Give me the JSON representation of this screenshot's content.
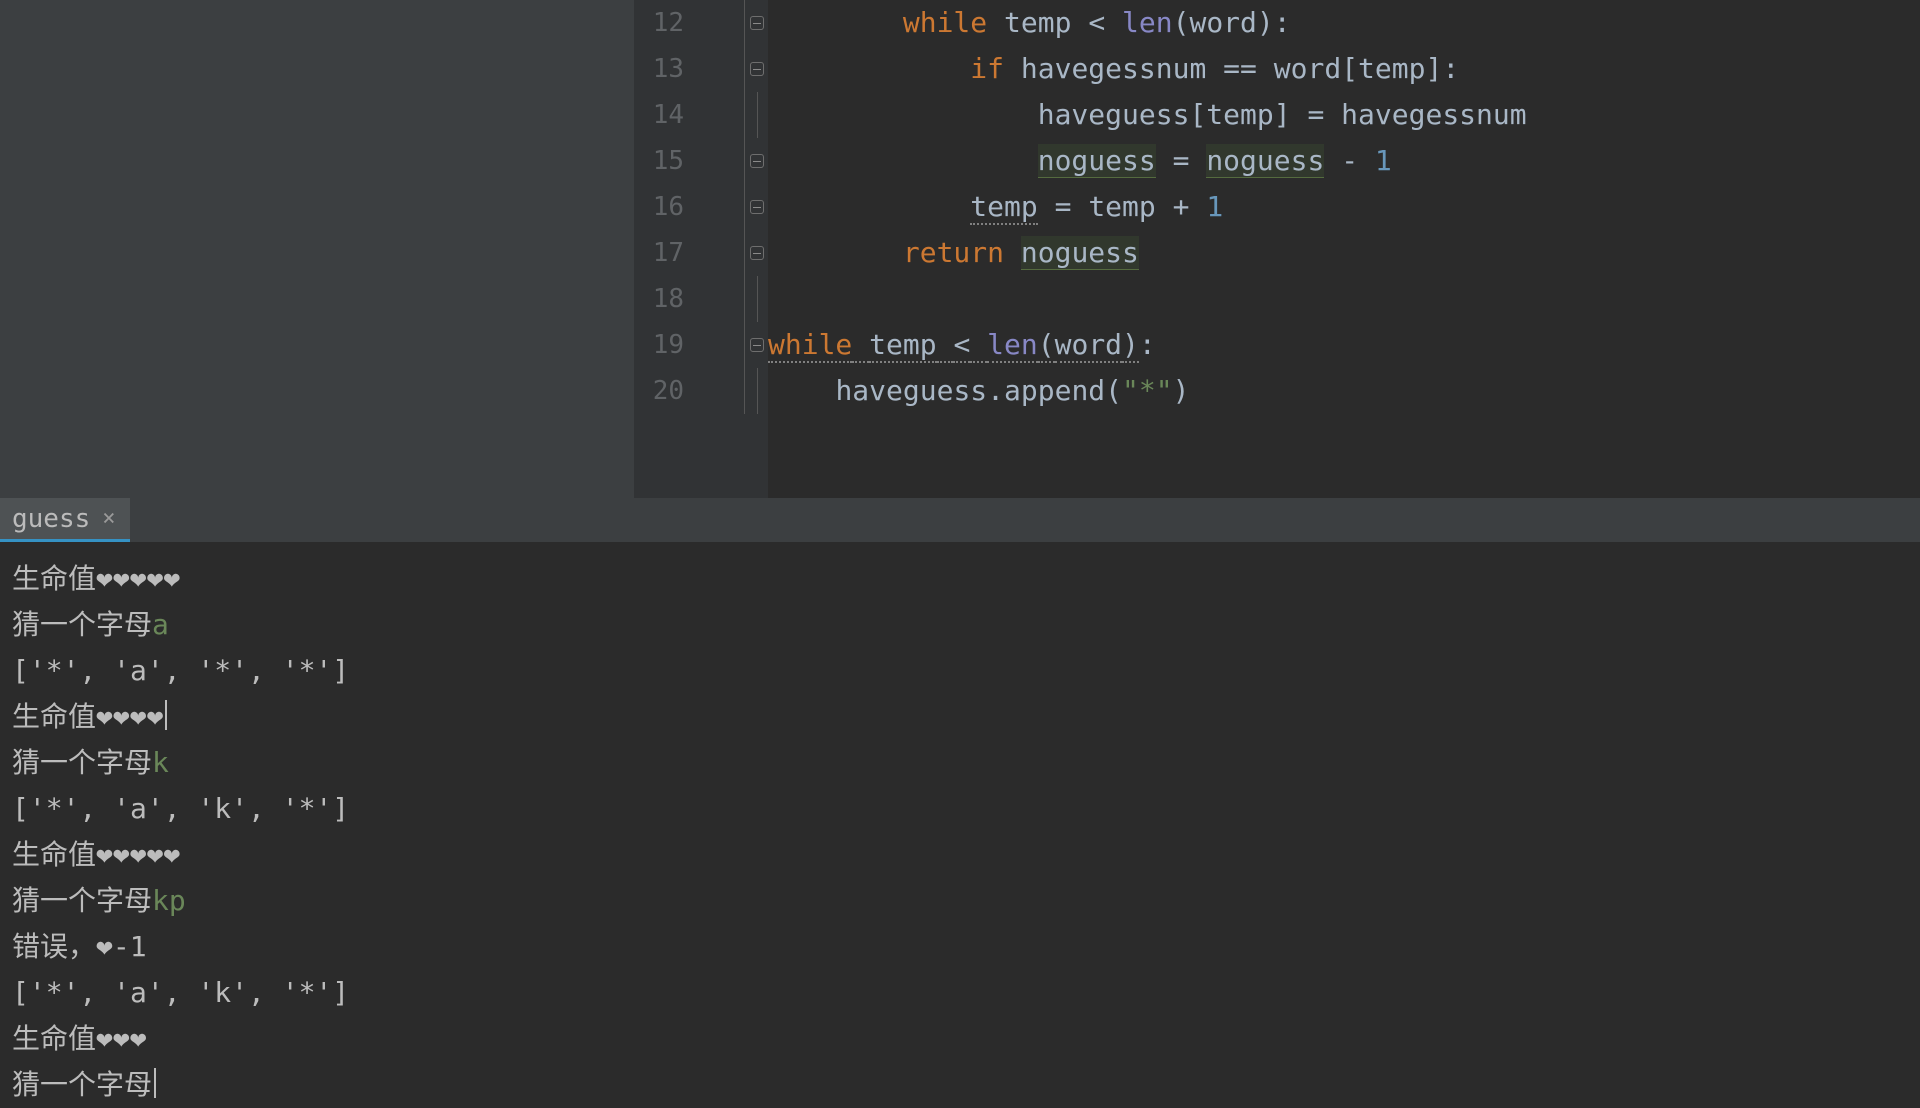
{
  "editor": {
    "lines": [
      {
        "num": "12",
        "fold": "mark",
        "tokens": [
          [
            "",
            "        "
          ],
          [
            "kw",
            "while"
          ],
          [
            "",
            " "
          ],
          [
            "id",
            "temp"
          ],
          [
            "",
            " "
          ],
          [
            "op",
            "<"
          ],
          [
            "",
            " "
          ],
          [
            "bn",
            "len"
          ],
          [
            "op",
            "("
          ],
          [
            "id",
            "word"
          ],
          [
            "op",
            ")"
          ],
          [
            "op",
            ":"
          ]
        ]
      },
      {
        "num": "13",
        "fold": "mark",
        "tokens": [
          [
            "",
            "            "
          ],
          [
            "kw",
            "if"
          ],
          [
            "",
            " "
          ],
          [
            "id",
            "havegessnum"
          ],
          [
            "",
            " "
          ],
          [
            "op",
            "=="
          ],
          [
            "",
            " "
          ],
          [
            "id",
            "word"
          ],
          [
            "op",
            "["
          ],
          [
            "id",
            "temp"
          ],
          [
            "op",
            "]"
          ],
          [
            "op",
            ":"
          ]
        ]
      },
      {
        "num": "14",
        "fold": "line",
        "tokens": [
          [
            "",
            "                "
          ],
          [
            "id",
            "haveguess"
          ],
          [
            "op",
            "["
          ],
          [
            "id",
            "temp"
          ],
          [
            "op",
            "]"
          ],
          [
            "",
            " "
          ],
          [
            "op",
            "="
          ],
          [
            "",
            " "
          ],
          [
            "id",
            "havegessnum"
          ]
        ]
      },
      {
        "num": "15",
        "fold": "mark",
        "tokens": [
          [
            "",
            "                "
          ],
          [
            "id hl",
            "noguess"
          ],
          [
            "",
            " "
          ],
          [
            "op",
            "="
          ],
          [
            "",
            " "
          ],
          [
            "id hl",
            "noguess"
          ],
          [
            "",
            " "
          ],
          [
            "op",
            "-"
          ],
          [
            "",
            " "
          ],
          [
            "num",
            "1"
          ]
        ]
      },
      {
        "num": "16",
        "fold": "mark",
        "tokens": [
          [
            "",
            "            "
          ],
          [
            "id uwave",
            "temp"
          ],
          [
            "",
            " "
          ],
          [
            "op",
            "="
          ],
          [
            "",
            " "
          ],
          [
            "id",
            "temp"
          ],
          [
            "",
            " "
          ],
          [
            "op",
            "+"
          ],
          [
            "",
            " "
          ],
          [
            "num",
            "1"
          ]
        ]
      },
      {
        "num": "17",
        "fold": "mark",
        "tokens": [
          [
            "",
            "        "
          ],
          [
            "kw",
            "return"
          ],
          [
            "",
            " "
          ],
          [
            "id hl",
            "noguess"
          ]
        ]
      },
      {
        "num": "18",
        "fold": "line",
        "tokens": [
          [
            "",
            ""
          ]
        ]
      },
      {
        "num": "19",
        "fold": "mark",
        "tokens": [
          [
            "kw uwave",
            "while"
          ],
          [
            "uwave",
            " "
          ],
          [
            "id uwave",
            "temp"
          ],
          [
            "uwave",
            " "
          ],
          [
            "op uwave",
            "<"
          ],
          [
            "uwave",
            " "
          ],
          [
            "bn uwave",
            "len"
          ],
          [
            "op uwave",
            "("
          ],
          [
            "id uwave",
            "word"
          ],
          [
            "op uwave",
            ")"
          ],
          [
            "op",
            ":"
          ]
        ]
      },
      {
        "num": "20",
        "fold": "line",
        "tokens": [
          [
            "",
            "    "
          ],
          [
            "id",
            "haveguess"
          ],
          [
            "op",
            "."
          ],
          [
            "id",
            "append"
          ],
          [
            "op",
            "("
          ],
          [
            "str",
            "\"*\""
          ],
          [
            "op",
            ")"
          ]
        ]
      }
    ]
  },
  "run": {
    "tab": "guess",
    "lines": [
      {
        "segments": [
          [
            "",
            "生命值❤❤❤❤❤"
          ]
        ]
      },
      {
        "segments": [
          [
            "",
            "猜一个字母"
          ],
          [
            "input",
            "a"
          ]
        ]
      },
      {
        "segments": [
          [
            "",
            "['*', 'a', '*', '*']"
          ]
        ]
      },
      {
        "segments": [
          [
            "",
            "生命值❤❤❤❤"
          ],
          [
            "caret",
            ""
          ]
        ]
      },
      {
        "segments": [
          [
            "",
            "猜一个字母"
          ],
          [
            "input",
            "k"
          ]
        ]
      },
      {
        "segments": [
          [
            "",
            "['*', 'a', 'k', '*']"
          ]
        ]
      },
      {
        "segments": [
          [
            "",
            "生命值❤❤❤❤❤"
          ]
        ]
      },
      {
        "segments": [
          [
            "",
            "猜一个字母"
          ],
          [
            "input",
            "kp"
          ]
        ]
      },
      {
        "segments": [
          [
            "",
            "错误，❤-1"
          ]
        ]
      },
      {
        "segments": [
          [
            "",
            "['*', 'a', 'k', '*']"
          ]
        ]
      },
      {
        "segments": [
          [
            "",
            "生命值❤❤❤"
          ]
        ]
      },
      {
        "segments": [
          [
            "",
            "猜一个字母"
          ],
          [
            "caret",
            ""
          ]
        ]
      }
    ]
  }
}
